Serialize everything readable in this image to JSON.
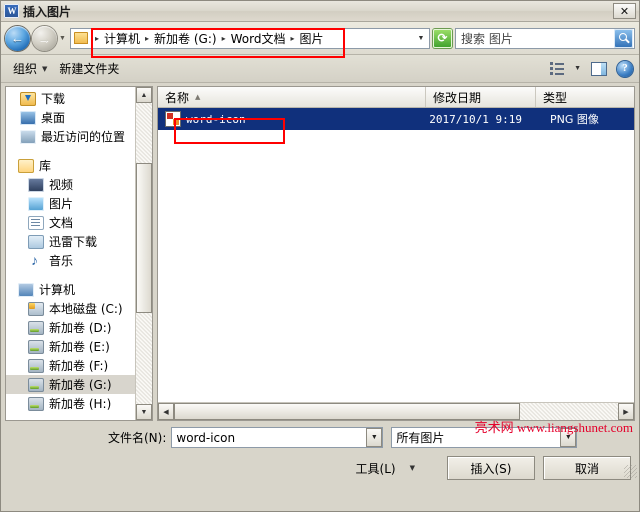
{
  "window": {
    "title": "插入图片",
    "app_icon": "word-icon",
    "close_label": "✕"
  },
  "address_bar": {
    "back_icon": "back-arrow-icon",
    "forward_icon": "forward-arrow-icon",
    "history_caret": "▼",
    "folder_icon": "folder-icon",
    "breadcrumbs": [
      "计算机",
      "新加卷 (G:)",
      "Word文档",
      "图片"
    ],
    "separator": "▸",
    "dropdown_caret": "▼",
    "refresh_icon": "refresh-icon",
    "search_placeholder": "搜索 图片",
    "search_icon": "search-icon"
  },
  "toolbar": {
    "organize_label": "组织",
    "organize_caret": "▼",
    "new_folder_label": "新建文件夹",
    "view_icon": "list-view-icon",
    "view_caret": "▼",
    "preview_icon": "preview-pane-icon",
    "help_icon": "help-icon",
    "help_glyph": "?"
  },
  "sidebar": {
    "items": [
      {
        "label": "下载",
        "icon": "download-folder-icon",
        "level": 1,
        "selected": false
      },
      {
        "label": "桌面",
        "icon": "desktop-icon",
        "level": 1,
        "selected": false
      },
      {
        "label": "最近访问的位置",
        "icon": "recent-places-icon",
        "level": 1,
        "selected": false
      },
      {
        "label": "库",
        "icon": "library-icon",
        "level": 0,
        "selected": false
      },
      {
        "label": "视频",
        "icon": "video-icon",
        "level": 1,
        "selected": false
      },
      {
        "label": "图片",
        "icon": "picture-icon",
        "level": 1,
        "selected": false
      },
      {
        "label": "文档",
        "icon": "document-icon",
        "level": 1,
        "selected": false
      },
      {
        "label": "迅雷下载",
        "icon": "thunder-download-icon",
        "level": 1,
        "selected": false
      },
      {
        "label": "音乐",
        "icon": "music-icon",
        "level": 1,
        "selected": false
      },
      {
        "label": "计算机",
        "icon": "computer-icon",
        "level": 0,
        "selected": false
      },
      {
        "label": "本地磁盘 (C:)",
        "icon": "system-drive-icon",
        "level": 1,
        "selected": false
      },
      {
        "label": "新加卷 (D:)",
        "icon": "drive-icon",
        "level": 1,
        "selected": false
      },
      {
        "label": "新加卷 (E:)",
        "icon": "drive-icon",
        "level": 1,
        "selected": false
      },
      {
        "label": "新加卷 (F:)",
        "icon": "drive-icon",
        "level": 1,
        "selected": false
      },
      {
        "label": "新加卷 (G:)",
        "icon": "drive-icon",
        "level": 1,
        "selected": true
      },
      {
        "label": "新加卷 (H:)",
        "icon": "drive-icon",
        "level": 1,
        "selected": false
      }
    ],
    "scroll_up": "▲",
    "scroll_down": "▼"
  },
  "file_list": {
    "columns": [
      {
        "label": "名称",
        "sorted": true,
        "sort_arrow": "▲"
      },
      {
        "label": "修改日期",
        "sorted": false,
        "sort_arrow": ""
      },
      {
        "label": "类型",
        "sorted": false,
        "sort_arrow": ""
      }
    ],
    "rows": [
      {
        "name": "word-icon",
        "date": "2017/10/1 9:19",
        "type": "PNG 图像",
        "icon": "image-file-icon",
        "selected": true
      }
    ],
    "hscroll_left": "◀",
    "hscroll_right": "▶"
  },
  "footer": {
    "filename_label": "文件名(N):",
    "filename_value": "word-icon",
    "filter_value": "所有图片",
    "dropdown_caret": "▼",
    "tools_label": "工具(L)",
    "tools_caret": "▼",
    "insert_label": "插入(S)",
    "cancel_label": "取消"
  },
  "watermark": {
    "text": "亮术网 www.liangshunet.com",
    "color": "#e4002b"
  },
  "colors": {
    "selection_blue": "#10307c",
    "annotation_red": "#ff0000",
    "chrome": "#d8d5ca"
  }
}
